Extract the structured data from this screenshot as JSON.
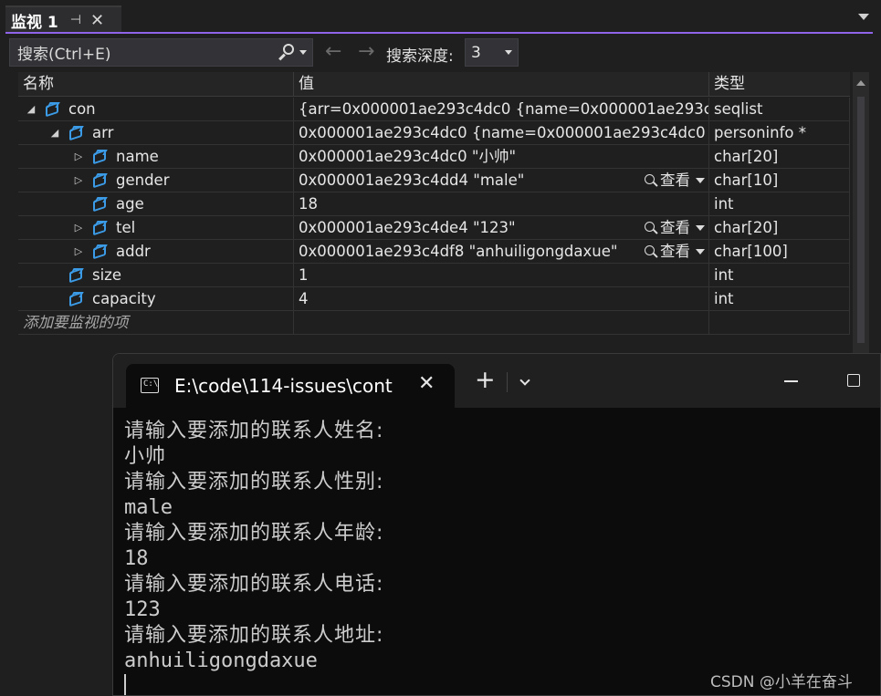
{
  "watch": {
    "tab_title": "监视 1",
    "pin_glyph": "⊣",
    "close_glyph": "✕",
    "search_placeholder": "搜索(Ctrl+E)",
    "back_glyph": "←",
    "forward_glyph": "→",
    "depth_label": "搜索深度:",
    "depth_value": "3",
    "columns": {
      "name": "名称",
      "value": "值",
      "type": "类型"
    },
    "rows": [
      {
        "name": "con",
        "value": "{arr=0x000001ae293c4dc0 {name=0x000001ae293c4d...",
        "type": "seqlist",
        "expander": "◢",
        "view": ""
      },
      {
        "name": "arr",
        "value": "0x000001ae293c4dc0 {name=0x000001ae293c4dc0 \"...",
        "type": "personinfo *",
        "expander": "◢",
        "view": ""
      },
      {
        "name": "name",
        "value": "0x000001ae293c4dc0 \"小帅\"",
        "type": "char[20]",
        "expander": "▷",
        "view": ""
      },
      {
        "name": "gender",
        "value": "0x000001ae293c4dd4 \"male\"",
        "type": "char[10]",
        "expander": "▷",
        "view": "查看"
      },
      {
        "name": "age",
        "value": "18",
        "type": "int",
        "expander": "",
        "view": ""
      },
      {
        "name": "tel",
        "value": "0x000001ae293c4de4 \"123\"",
        "type": "char[20]",
        "expander": "▷",
        "view": "查看"
      },
      {
        "name": "addr",
        "value": "0x000001ae293c4df8 \"anhuiligongdaxue\"",
        "type": "char[100]",
        "expander": "▷",
        "view": "查看"
      },
      {
        "name": "size",
        "value": "1",
        "type": "int",
        "expander": "",
        "view": ""
      },
      {
        "name": "capacity",
        "value": "4",
        "type": "int",
        "expander": "",
        "view": ""
      }
    ],
    "add_item_placeholder": "添加要监视的项"
  },
  "terminal": {
    "tab_title": "E:\\code\\114-issues\\cont",
    "icon_text": "C:\\",
    "close_glyph": "✕",
    "new_tab_glyph": "+",
    "lines": [
      "请输入要添加的联系人姓名:",
      "小帅",
      "请输入要添加的联系人性别:",
      "male",
      "请输入要添加的联系人年龄:",
      "18",
      "请输入要添加的联系人电话:",
      "123",
      "请输入要添加的联系人地址:",
      "anhuiligongdaxue"
    ]
  },
  "watermark": "CSDN @小羊在奋斗"
}
